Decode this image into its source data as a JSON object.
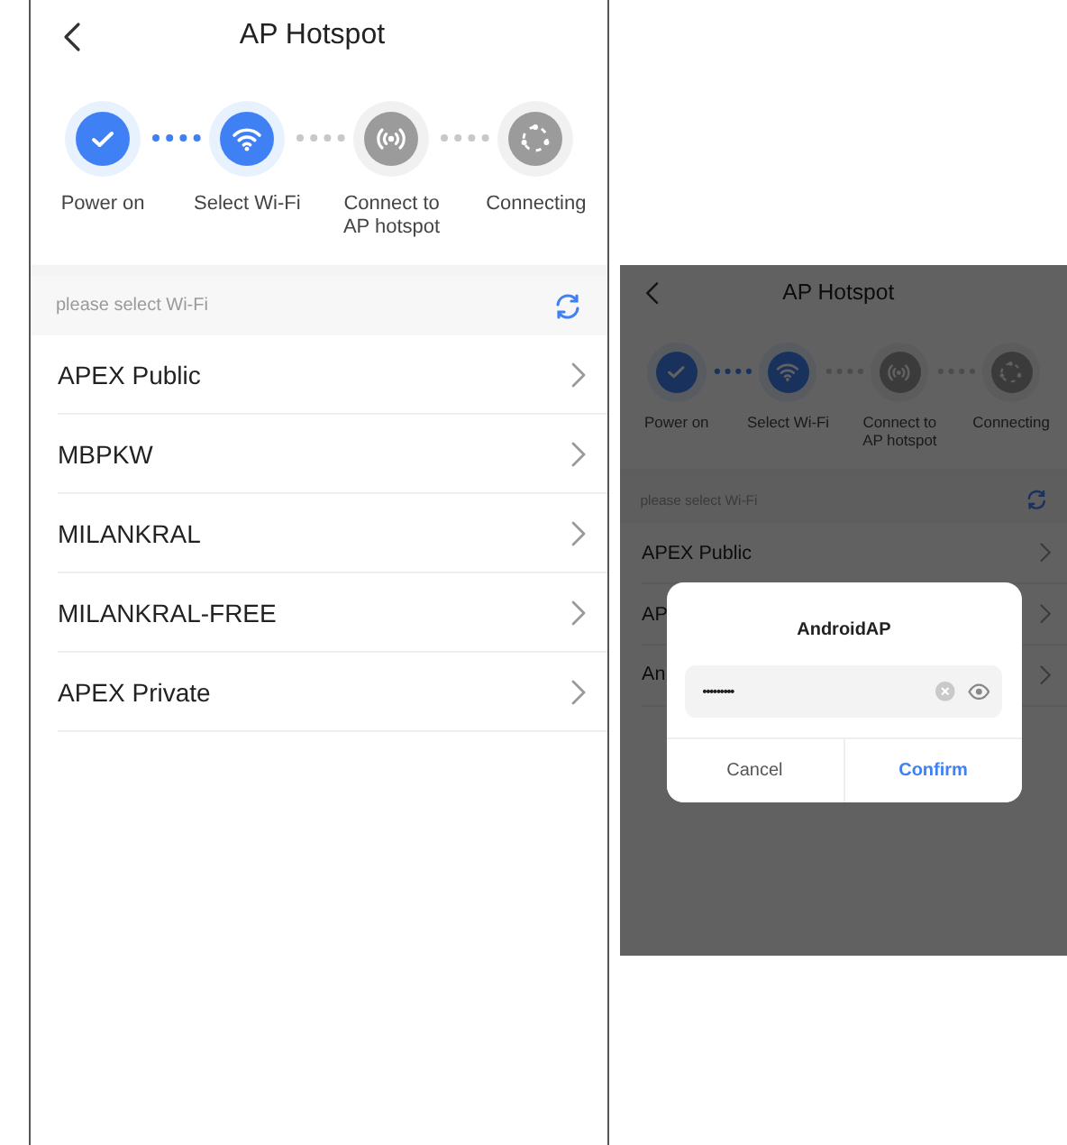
{
  "screens": [
    {
      "header": {
        "title": "AP Hotspot"
      },
      "steps": [
        {
          "kind": "check",
          "label": "Power on",
          "active": true
        },
        {
          "kind": "wifi",
          "label": "Select Wi-Fi",
          "active": true
        },
        {
          "kind": "signal",
          "label": "Connect to AP hotspot",
          "active": false
        },
        {
          "kind": "spinner",
          "label": "Connecting",
          "active": false
        }
      ],
      "list_header": "please select Wi-Fi",
      "networks": [
        "APEX Public",
        "MBPKW",
        "MILANKRAL",
        "MILANKRAL-FREE",
        "APEX Private"
      ]
    },
    {
      "header": {
        "title": "AP Hotspot"
      },
      "steps": [
        {
          "kind": "check",
          "label": "Power on",
          "active": true
        },
        {
          "kind": "wifi",
          "label": "Select Wi-Fi",
          "active": true
        },
        {
          "kind": "signal",
          "label": "Connect to AP hotspot",
          "active": false
        },
        {
          "kind": "spinner",
          "label": "Connecting",
          "active": false
        }
      ],
      "list_header": "please select Wi-Fi",
      "networks": [
        "APEX Public",
        "AP",
        "An"
      ],
      "dialog": {
        "title": "AndroidAP",
        "password": "•••••••••",
        "buttons": [
          {
            "kind": "cancel",
            "label": "Cancel"
          },
          {
            "kind": "confirm",
            "label": "Confirm"
          }
        ]
      }
    }
  ]
}
